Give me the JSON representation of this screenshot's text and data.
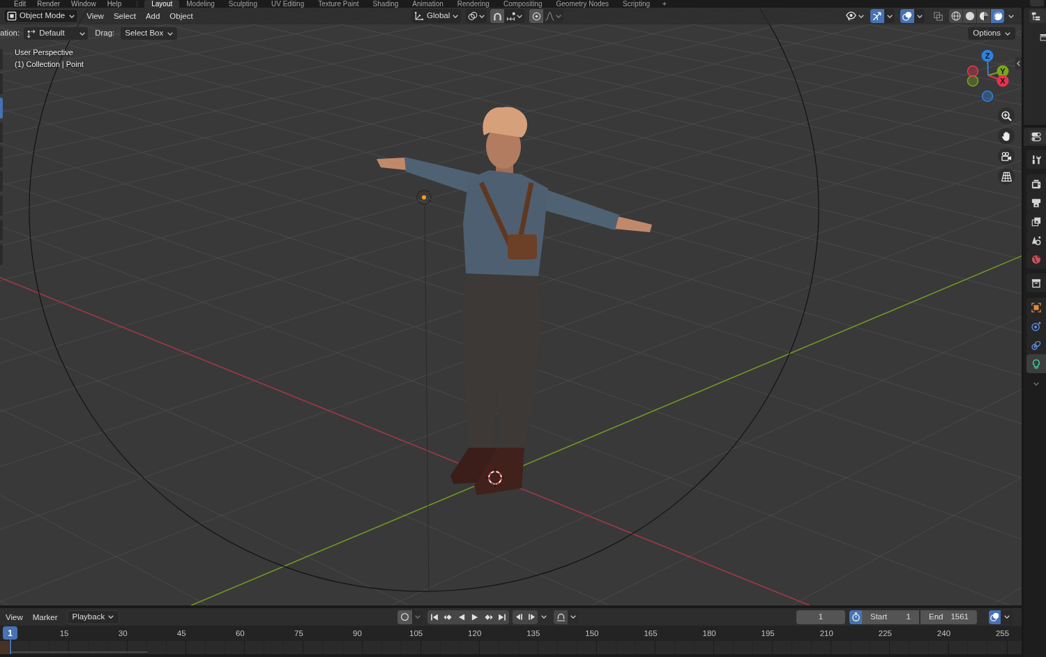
{
  "top_bar": {
    "menus": [
      "Edit",
      "Render",
      "Window",
      "Help"
    ],
    "workspaces": [
      {
        "label": "Layout",
        "selected": true
      },
      {
        "label": "Modeling",
        "selected": false
      },
      {
        "label": "Sculpting",
        "selected": false
      },
      {
        "label": "UV Editing",
        "selected": false
      },
      {
        "label": "Texture Paint",
        "selected": false
      },
      {
        "label": "Shading",
        "selected": false
      },
      {
        "label": "Animation",
        "selected": false
      },
      {
        "label": "Rendering",
        "selected": false
      },
      {
        "label": "Compositing",
        "selected": false
      },
      {
        "label": "Geometry Nodes",
        "selected": false
      },
      {
        "label": "Scripting",
        "selected": false
      }
    ],
    "add_workspace": "+"
  },
  "viewport_header": {
    "mode": "Object Mode",
    "menus": [
      "View",
      "Select",
      "Add",
      "Object"
    ],
    "orientation": "Global",
    "snap": false,
    "proportional_editing": false,
    "gizmos": true,
    "overlays": true,
    "xray": false,
    "shading_modes": [
      {
        "kind": "wireframe",
        "selected": false
      },
      {
        "kind": "solid",
        "selected": false
      },
      {
        "kind": "material",
        "selected": false
      },
      {
        "kind": "rendered",
        "selected": true
      }
    ]
  },
  "tool_settings": {
    "orientation_label": "ation:",
    "orientation": "Default",
    "drag_label": "Drag:",
    "drag": "Select Box",
    "options": "Options"
  },
  "toolbar_tools": [
    {
      "selected": false
    },
    {
      "selected": false
    },
    {
      "selected": true
    },
    {
      "selected": false
    },
    {
      "selected": false
    },
    {
      "selected": false
    },
    {
      "selected": false
    },
    {
      "selected": false
    },
    {
      "selected": false
    }
  ],
  "viewport": {
    "view_name": "User Perspective",
    "collection_info": "(1) Collection | Point",
    "gizmo_axes": [
      {
        "label": "Z",
        "color": "#2f80e2"
      },
      {
        "label": "Y",
        "color": "#7ba51e"
      },
      {
        "label": "X",
        "color": "#e5344f"
      }
    ]
  },
  "properties_tabs": [
    {
      "kind": "tool",
      "selected": false
    },
    {
      "kind": "render",
      "selected": false
    },
    {
      "kind": "output",
      "selected": false
    },
    {
      "kind": "view_layer",
      "selected": false
    },
    {
      "kind": "scene",
      "selected": false
    },
    {
      "kind": "world",
      "selected": false
    },
    {
      "kind": "collection",
      "selected": false
    },
    {
      "kind": "object",
      "selected": false
    },
    {
      "kind": "physics",
      "selected": false
    },
    {
      "kind": "constraints",
      "selected": false
    },
    {
      "kind": "data",
      "selected": true
    }
  ],
  "timeline": {
    "menus": [
      "View",
      "Marker"
    ],
    "playback": "Playback",
    "auto_keying": false,
    "current_frame": "1",
    "preview_range": true,
    "start_label": "Start",
    "start": "1",
    "end_label": "End",
    "end": "1561",
    "sync": true,
    "playhead": "1",
    "frame_labels": [
      "15",
      "30",
      "45",
      "60",
      "75",
      "90",
      "105",
      "120",
      "135",
      "150",
      "165",
      "180",
      "195",
      "210",
      "225",
      "240",
      "255"
    ]
  }
}
